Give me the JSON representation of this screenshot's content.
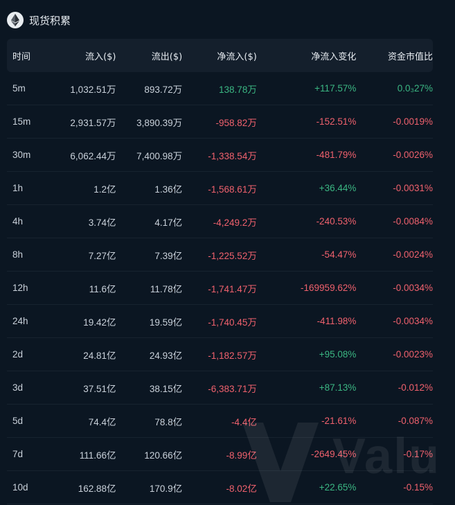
{
  "header": {
    "title": "现货积累",
    "logo_icon": "ethereum-icon"
  },
  "columns": [
    "时间",
    "流入($)",
    "流出($)",
    "净流入($)",
    "净流入变化",
    "资金市值比"
  ],
  "colors": {
    "positive": "#3bb783",
    "negative": "#f0616d",
    "background": "#0b1622",
    "header_bg": "#141f2c"
  },
  "rows": [
    {
      "time": "5m",
      "inflow": "1,032.51万",
      "outflow": "893.72万",
      "net": "138.78万",
      "net_sign": "pos",
      "change": "+117.57%",
      "change_sign": "pos",
      "ratio": "0.0₃27%",
      "ratio_sign": "pos"
    },
    {
      "time": "15m",
      "inflow": "2,931.57万",
      "outflow": "3,890.39万",
      "net": "-958.82万",
      "net_sign": "neg",
      "change": "-152.51%",
      "change_sign": "neg",
      "ratio": "-0.0019%",
      "ratio_sign": "neg"
    },
    {
      "time": "30m",
      "inflow": "6,062.44万",
      "outflow": "7,400.98万",
      "net": "-1,338.54万",
      "net_sign": "neg",
      "change": "-481.79%",
      "change_sign": "neg",
      "ratio": "-0.0026%",
      "ratio_sign": "neg"
    },
    {
      "time": "1h",
      "inflow": "1.2亿",
      "outflow": "1.36亿",
      "net": "-1,568.61万",
      "net_sign": "neg",
      "change": "+36.44%",
      "change_sign": "pos",
      "ratio": "-0.0031%",
      "ratio_sign": "neg"
    },
    {
      "time": "4h",
      "inflow": "3.74亿",
      "outflow": "4.17亿",
      "net": "-4,249.2万",
      "net_sign": "neg",
      "change": "-240.53%",
      "change_sign": "neg",
      "ratio": "-0.0084%",
      "ratio_sign": "neg"
    },
    {
      "time": "8h",
      "inflow": "7.27亿",
      "outflow": "7.39亿",
      "net": "-1,225.52万",
      "net_sign": "neg",
      "change": "-54.47%",
      "change_sign": "neg",
      "ratio": "-0.0024%",
      "ratio_sign": "neg"
    },
    {
      "time": "12h",
      "inflow": "11.6亿",
      "outflow": "11.78亿",
      "net": "-1,741.47万",
      "net_sign": "neg",
      "change": "-169959.62%",
      "change_sign": "neg",
      "ratio": "-0.0034%",
      "ratio_sign": "neg"
    },
    {
      "time": "24h",
      "inflow": "19.42亿",
      "outflow": "19.59亿",
      "net": "-1,740.45万",
      "net_sign": "neg",
      "change": "-411.98%",
      "change_sign": "neg",
      "ratio": "-0.0034%",
      "ratio_sign": "neg"
    },
    {
      "time": "2d",
      "inflow": "24.81亿",
      "outflow": "24.93亿",
      "net": "-1,182.57万",
      "net_sign": "neg",
      "change": "+95.08%",
      "change_sign": "pos",
      "ratio": "-0.0023%",
      "ratio_sign": "neg"
    },
    {
      "time": "3d",
      "inflow": "37.51亿",
      "outflow": "38.15亿",
      "net": "-6,383.71万",
      "net_sign": "neg",
      "change": "+87.13%",
      "change_sign": "pos",
      "ratio": "-0.012%",
      "ratio_sign": "neg"
    },
    {
      "time": "5d",
      "inflow": "74.4亿",
      "outflow": "78.8亿",
      "net": "-4.4亿",
      "net_sign": "neg",
      "change": "-21.61%",
      "change_sign": "neg",
      "ratio": "-0.087%",
      "ratio_sign": "neg"
    },
    {
      "time": "7d",
      "inflow": "111.66亿",
      "outflow": "120.66亿",
      "net": "-8.99亿",
      "net_sign": "neg",
      "change": "-2649.45%",
      "change_sign": "neg",
      "ratio": "-0.17%",
      "ratio_sign": "neg"
    },
    {
      "time": "10d",
      "inflow": "162.88亿",
      "outflow": "170.9亿",
      "net": "-8.02亿",
      "net_sign": "neg",
      "change": "+22.65%",
      "change_sign": "pos",
      "ratio": "-0.15%",
      "ratio_sign": "neg"
    }
  ],
  "watermark": {
    "text": "Valu",
    "icon": "valuescan-logo-icon"
  }
}
